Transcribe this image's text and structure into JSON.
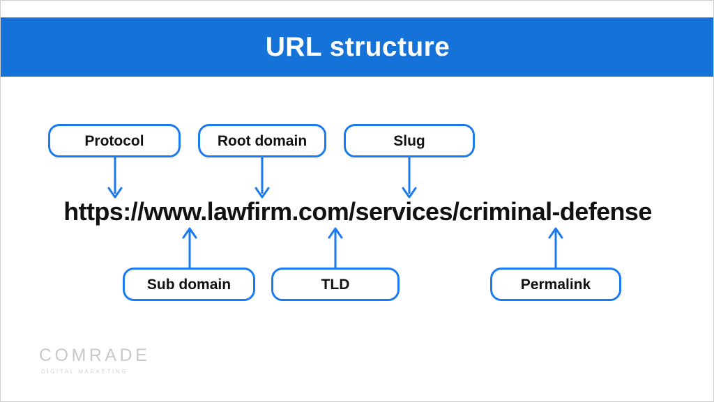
{
  "slide": {
    "title": "URL structure",
    "accent_color": "#1572D9",
    "box_border_color": "#1A7AEE",
    "arrow_color": "#1A7AEE",
    "text_color": "#111111",
    "background_color": "#FFFFFF"
  },
  "url": {
    "full": "https://www.lawfirm.com/services/criminal-defense"
  },
  "top_labels": [
    {
      "text": "Protocol"
    },
    {
      "text": "Root domain"
    },
    {
      "text": "Slug"
    }
  ],
  "bottom_labels": [
    {
      "text": "Sub domain"
    },
    {
      "text": "TLD"
    },
    {
      "text": "Permalink"
    }
  ],
  "watermark": {
    "name": "COMRADE",
    "tagline": "DIGITAL MARKETING",
    "color": "#C9C9C9"
  }
}
